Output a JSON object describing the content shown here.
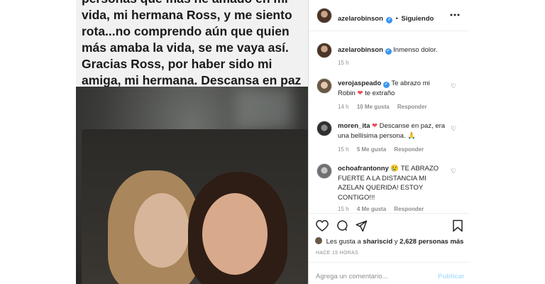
{
  "post": {
    "caption": "personas que más he amado en mi vida, mi hermana Ross, y me siento rota...no comprendo aún que quien más amaba la vida, se me vaya así. Gracias Ross, por haber sido mi amiga, mi hermana. Descansa en paz mi chiquita!"
  },
  "header": {
    "username": "azelarobinson",
    "separator": "•",
    "follow_label": "Siguiendo",
    "more_icon": "more-horizontal-icon",
    "verified_icon": "verified-badge-icon"
  },
  "comments": [
    {
      "username": "azelarobinson",
      "text": "Inmenso dolor.",
      "time": "15 h",
      "likes": "",
      "reply": ""
    },
    {
      "username": "verojaspeado",
      "text": "Te abrazo mi Robin",
      "heart": "❤",
      "text_after": "te extraño",
      "time": "14 h",
      "likes": "10 Me gusta",
      "reply": "Responder"
    },
    {
      "username": "moren_ita",
      "heart": "❤",
      "text": "Descanse en paz, era una bellísima persona.",
      "emoji": "🙏",
      "time": "15 h",
      "likes": "5 Me gusta",
      "reply": "Responder"
    },
    {
      "username": "ochoafrantonny",
      "emoji": "😢",
      "text": "TE ABRAZO FUERTE A LA DISTANCIA MI AZELAN QUERIDA! ESTOY CONTIGO!!!",
      "time": "15 h",
      "likes": "4 Me gusta",
      "reply": "Responder"
    }
  ],
  "actions": {
    "icons": [
      "heart-icon",
      "comment-icon",
      "share-icon",
      "bookmark-icon"
    ]
  },
  "likes": {
    "prefix": "Les gusta a",
    "user": "shariscid",
    "middle": "y",
    "count": "2,628 personas más"
  },
  "time_ago": "HACE 15 HORAS",
  "add_comment": {
    "placeholder": "Agrega un comentario...",
    "post_label": "Publicar"
  },
  "colors": {
    "verified": "#3897f0",
    "heart_red": "#ed4956",
    "link_disabled": "#b2dffc",
    "meta_gray": "#8e8e8e"
  }
}
